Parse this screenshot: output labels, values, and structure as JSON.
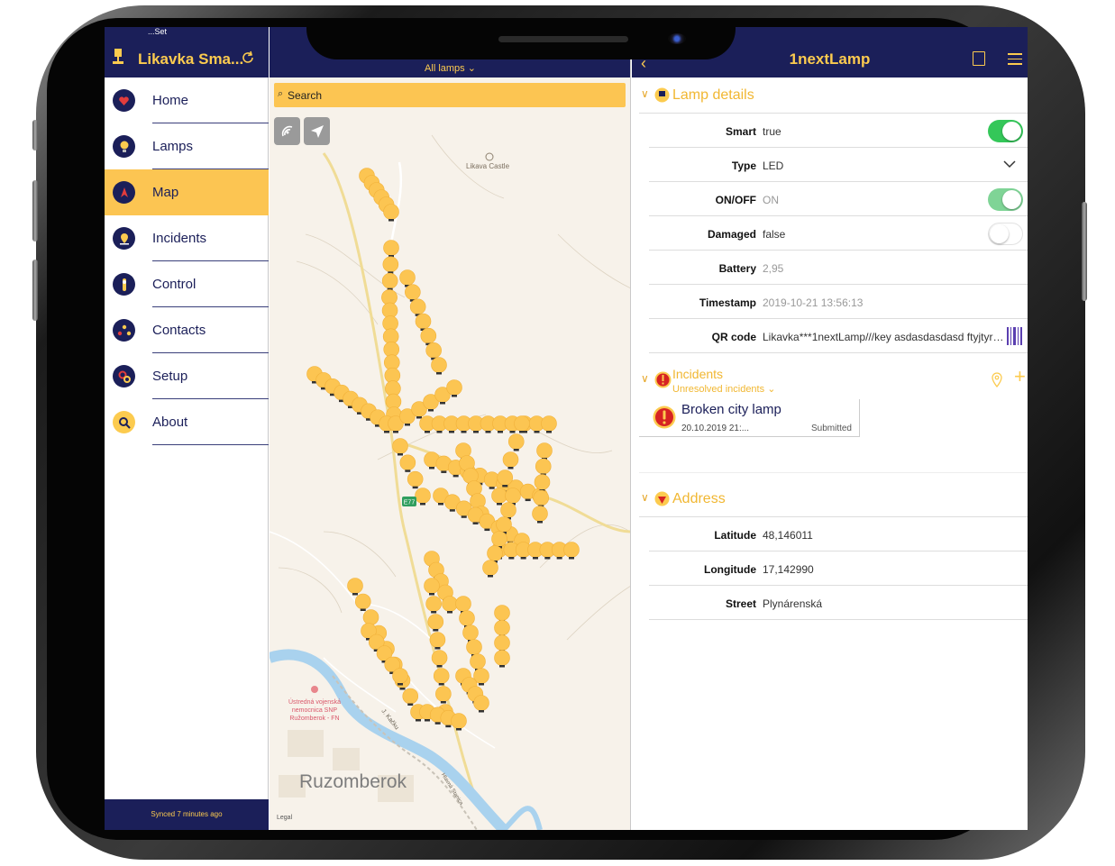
{
  "status_bar": {
    "text": "...Set"
  },
  "sidebar": {
    "title": "Likavka Sma...",
    "items": [
      {
        "label": "Home",
        "icon": "home-icon"
      },
      {
        "label": "Lamps",
        "icon": "lamp-icon"
      },
      {
        "label": "Map",
        "icon": "compass-icon",
        "active": true
      },
      {
        "label": "Incidents",
        "icon": "incident-icon"
      },
      {
        "label": "Control",
        "icon": "control-icon"
      },
      {
        "label": "Contacts",
        "icon": "contacts-icon"
      },
      {
        "label": "Setup",
        "icon": "setup-icon"
      },
      {
        "label": "About",
        "icon": "search-icon"
      }
    ],
    "footer": "Synced 7 minutes ago"
  },
  "map": {
    "filter": "All lamps",
    "search_placeholder": "Search",
    "labels": {
      "castle": "Likava Castle",
      "hospital": "Ústredná vojenská nemocnica SNP Ružomberok - FN",
      "city": "Ruzomberok",
      "road_e77": "E77",
      "street_kacku": "J. Kačku",
      "street_hlavna": "Hlavná Stanica",
      "legal": "Legal"
    }
  },
  "detail": {
    "title": "1nextLamp",
    "lamp_details_title": "Lamp details",
    "rows": [
      {
        "key": "Smart",
        "value": "true"
      },
      {
        "key": "Type",
        "value": "LED"
      },
      {
        "key": "ON/OFF",
        "value": "ON"
      },
      {
        "key": "Damaged",
        "value": "false"
      },
      {
        "key": "Battery",
        "value": "2,95"
      },
      {
        "key": "Timestamp",
        "value": "2019-10-21 13:56:13"
      },
      {
        "key": "QR code",
        "value": "Likavka***1nextLamp///key asdasdasdasd ftyjtyrnryu..."
      }
    ],
    "toggles": {
      "smart": true,
      "on_off": true,
      "damaged": false
    },
    "incidents": {
      "title": "Incidents",
      "filter": "Unresolved incidents",
      "card": {
        "title": "Broken city lamp",
        "date": "20.10.2019 21:...",
        "status": "Submitted"
      }
    },
    "address": {
      "title": "Address",
      "rows": [
        {
          "key": "Latitude",
          "value": "48,146011"
        },
        {
          "key": "Longitude",
          "value": "17,142990"
        },
        {
          "key": "Street",
          "value": "Plynárenská"
        }
      ]
    }
  },
  "colors": {
    "navy": "#1b1f59",
    "gold": "#fccb4f",
    "accent": "#fcc552",
    "green": "#34c759"
  }
}
